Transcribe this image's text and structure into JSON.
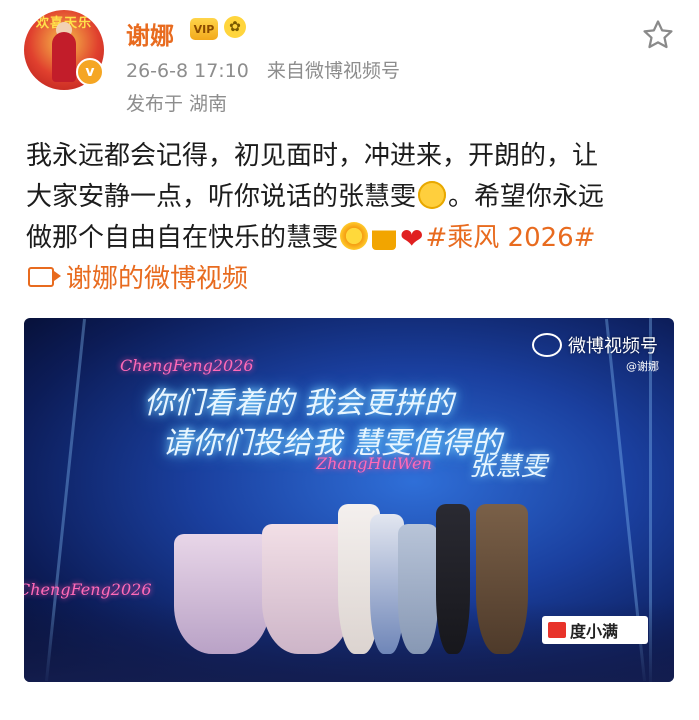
{
  "author": {
    "name": "谢娜",
    "avatar_text": "欢喜天乐",
    "verified_mark": "v",
    "badge_crown": "VIP",
    "badge_sun": "✿"
  },
  "post_meta": {
    "time": "26-6-8 17:10",
    "source_prefix": "来自",
    "source": "微博视频号",
    "location": "发布于 湖南"
  },
  "content": {
    "line1": "我永远都会记得，初见面时，冲进来，开朗的，让",
    "line2_a": "大家安静一点，听你说话的张慧雯",
    "line2_b": "。希望你永远",
    "line3_a": "做那个自由自在快乐的慧雯",
    "heart": "❤",
    "topic": "#乘风 2026#",
    "video_link": "谢娜的微博视频"
  },
  "media": {
    "neon_line1": "你们看着的 我会更拼的",
    "neon_line2": "请你们投给我 慧雯值得的",
    "neon_signature": "张慧雯",
    "script_top": "ChengFeng2026",
    "script_mid": "ZhangHuiWen",
    "script_left": "ChengFeng2026",
    "watermark": "微博视频号",
    "watermark_user": "@谢娜",
    "sponsor": "度小满"
  },
  "icons": {
    "favorite": "star-outline-icon"
  }
}
